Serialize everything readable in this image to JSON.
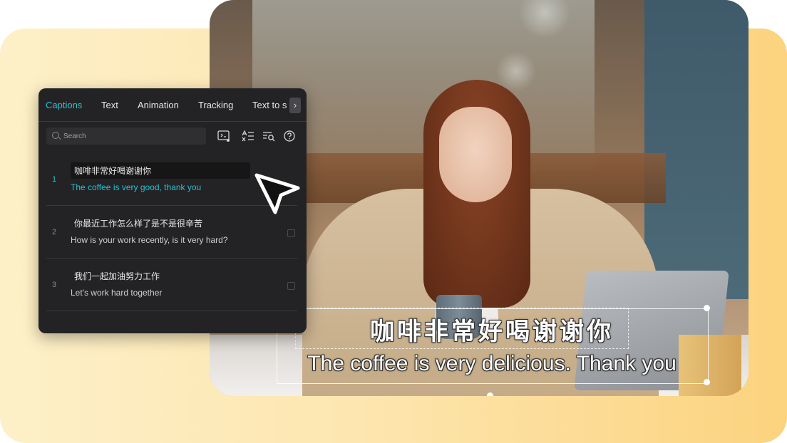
{
  "panel": {
    "tabs": [
      {
        "label": "Captions",
        "active": true
      },
      {
        "label": "Text",
        "active": false
      },
      {
        "label": "Animation",
        "active": false
      },
      {
        "label": "Tracking",
        "active": false
      },
      {
        "label": "Text to s",
        "active": false
      }
    ],
    "tab_scroll_icon": "chevron-right-icon",
    "search": {
      "placeholder": "Search",
      "value": ""
    },
    "toolbar_icons": [
      "auto-caption-icon",
      "text-format-icon",
      "find-replace-icon",
      "help-icon"
    ],
    "captions": [
      {
        "index": "1",
        "original": "咖啡非常好喝谢谢你",
        "translation": "The coffee is very good, thank you",
        "selected": true
      },
      {
        "index": "2",
        "original": "你最近工作怎么样了是不是很辛苦",
        "translation": "How is your work recently, is it very hard?",
        "selected": false
      },
      {
        "index": "3",
        "original": "我们一起加油努力工作",
        "translation": "Let's work hard together",
        "selected": false
      }
    ]
  },
  "video": {
    "subtitle_zh": "咖啡非常好喝谢谢你",
    "subtitle_en": "The coffee is very delicious. Thank you"
  },
  "colors": {
    "accent": "#23c4d6",
    "panel_bg": "#232325",
    "background_gradient_start": "#fdf0c8",
    "background_gradient_end": "#fcd37e"
  }
}
